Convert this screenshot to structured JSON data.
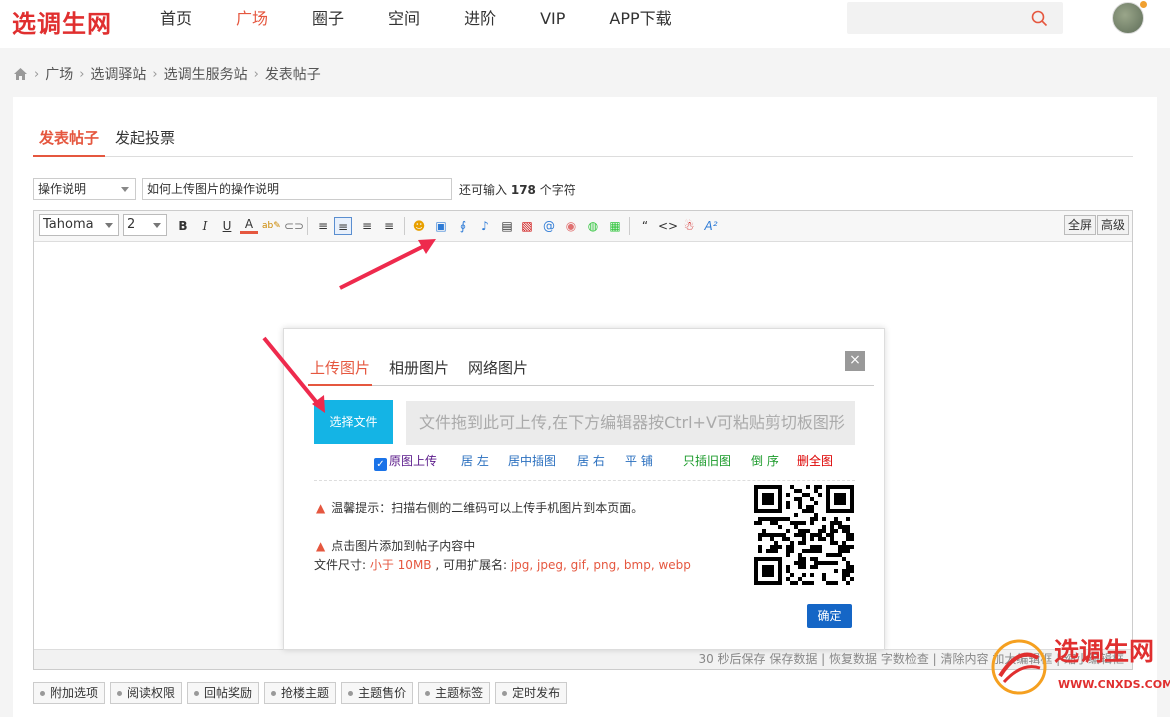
{
  "site": {
    "logo": "选调生网"
  },
  "nav": {
    "items": [
      "首页",
      "广场",
      "圈子",
      "空间",
      "进阶",
      "VIP",
      "APP下载"
    ],
    "active_index": 1
  },
  "breadcrumb": [
    "广场",
    "选调驿站",
    "选调生服务站",
    "发表帖子"
  ],
  "tabs": [
    "发表帖子",
    "发起投票"
  ],
  "form": {
    "category": "操作说明",
    "title": "如何上传图片的操作说明",
    "remain_prefix": "还可输入",
    "remain_count": "178",
    "remain_suffix": "个字符"
  },
  "editor": {
    "font": "Tahoma",
    "size": "2",
    "fullscreen": "全屏",
    "advanced": "高级",
    "status": "30 秒后保存 保存数据 | 恢复数据    字数检查 | 清除内容    加大编辑框 | 缩小编辑框"
  },
  "dialog": {
    "tabs": [
      "上传图片",
      "相册图片",
      "网络图片"
    ],
    "close": "×",
    "choose_button": "选择文件",
    "dropzone": "文件拖到此可上传,在下方编辑器按Ctrl+V可粘贴剪切板图形",
    "options": {
      "original": "原图上传",
      "left": "居 左",
      "center": "居中插图",
      "right": "居 右",
      "tile": "平 铺",
      "only_old": "只插旧图",
      "reverse": "倒 序",
      "delete_all": "删全图"
    },
    "tip1": "温馨提示：扫描右侧的二维码可以上传手机图片到本页面。",
    "tip2": "点击图片添加到帖子内容中",
    "size_prefix": "文件尺寸: ",
    "size_value": "小于 10MB",
    "ext_prefix": " , 可用扩展名: ",
    "ext_value": "jpg, jpeg, gif, png, bmp, webp",
    "ok": "确定"
  },
  "bottom_buttons": [
    "附加选项",
    "阅读权限",
    "回帖奖励",
    "抢楼主题",
    "主题售价",
    "主题标签",
    "定时发布"
  ],
  "watermark": {
    "text": "选调生网",
    "url": "WWW.CNXDS.COM"
  },
  "colors": {
    "accent": "#e5573f",
    "brand": "#e02f2f",
    "primary": "#1566c6",
    "upload": "#14b4e5"
  }
}
